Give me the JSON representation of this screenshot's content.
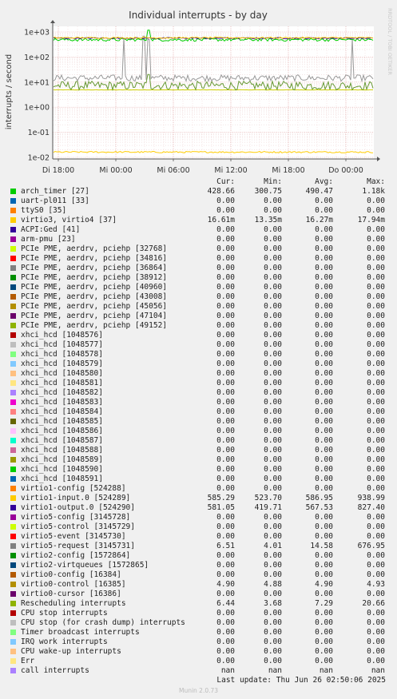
{
  "chart_data": {
    "type": "line",
    "title": "Individual interrupts - by day",
    "ylabel": "interrupts / second",
    "yscale": "log",
    "ylim": [
      0.01,
      1000
    ],
    "y_ticks": [
      {
        "v": 1000,
        "label": "1e+03"
      },
      {
        "v": 100,
        "label": "1e+02"
      },
      {
        "v": 10,
        "label": "1e+01"
      },
      {
        "v": 1,
        "label": "1e+00"
      },
      {
        "v": 0.1,
        "label": "1e-01"
      },
      {
        "v": 0.01,
        "label": "1e-02"
      }
    ],
    "x_ticks": [
      "Di 18:00",
      "Mi 00:00",
      "Mi 06:00",
      "Mi 12:00",
      "Mi 18:00",
      "Do 00:00"
    ],
    "grid": true,
    "side_label": "RRDTOOL / TOBI OETIKER",
    "series": [
      {
        "name": "arch_timer [27]",
        "color": "#00cc00",
        "cur": 428.66,
        "min": 300.75,
        "avg": 490.47,
        "max": 1180
      },
      {
        "name": "virtio3, virtio4 [37]",
        "color": "#ffcc00",
        "cur": 0.01661,
        "min": 0.01335,
        "avg": 0.01627,
        "max": 0.01794
      },
      {
        "name": "virtio1-input.0 [524289]",
        "color": "#ffcc00",
        "cur": 585.29,
        "min": 523.7,
        "avg": 586.95,
        "max": 938.99
      },
      {
        "name": "virtio1-output.0 [524290]",
        "color": "#330099",
        "cur": 581.05,
        "min": 419.71,
        "avg": 567.53,
        "max": 827.4
      },
      {
        "name": "virtio5-request [3145731]",
        "color": "#999999",
        "cur": 6.51,
        "min": 4.01,
        "avg": 14.58,
        "max": 676.95
      },
      {
        "name": "virtio0-control [16385]",
        "color": "#cccc00",
        "cur": 4.9,
        "min": 4.88,
        "avg": 4.9,
        "max": 4.93
      },
      {
        "name": "Rescheduling interrupts",
        "color": "#669933",
        "cur": 6.44,
        "min": 3.68,
        "avg": 7.29,
        "max": 20.66
      }
    ]
  },
  "legend": {
    "headers": [
      "Cur:",
      "Min:",
      "Avg:",
      "Max:"
    ],
    "rows": [
      {
        "color": "#00cc00",
        "name": "arch_timer [27]",
        "cur": "428.66",
        "min": "300.75",
        "avg": "490.47",
        "max": "1.18k"
      },
      {
        "color": "#0066b3",
        "name": "uart-pl011 [33]",
        "cur": "0.00",
        "min": "0.00",
        "avg": "0.00",
        "max": "0.00"
      },
      {
        "color": "#ff8000",
        "name": "ttyS0 [35]",
        "cur": "0.00",
        "min": "0.00",
        "avg": "0.00",
        "max": "0.00"
      },
      {
        "color": "#ffcc00",
        "name": "virtio3, virtio4 [37]",
        "cur": "16.61m",
        "min": "13.35m",
        "avg": "16.27m",
        "max": "17.94m"
      },
      {
        "color": "#330099",
        "name": "ACPI:Ged [41]",
        "cur": "0.00",
        "min": "0.00",
        "avg": "0.00",
        "max": "0.00"
      },
      {
        "color": "#990099",
        "name": "arm-pmu [23]",
        "cur": "0.00",
        "min": "0.00",
        "avg": "0.00",
        "max": "0.00"
      },
      {
        "color": "#ccff00",
        "name": "PCIe PME, aerdrv, pciehp [32768]",
        "cur": "0.00",
        "min": "0.00",
        "avg": "0.00",
        "max": "0.00"
      },
      {
        "color": "#ff0000",
        "name": "PCIe PME, aerdrv, pciehp [34816]",
        "cur": "0.00",
        "min": "0.00",
        "avg": "0.00",
        "max": "0.00"
      },
      {
        "color": "#808080",
        "name": "PCIe PME, aerdrv, pciehp [36864]",
        "cur": "0.00",
        "min": "0.00",
        "avg": "0.00",
        "max": "0.00"
      },
      {
        "color": "#008f00",
        "name": "PCIe PME, aerdrv, pciehp [38912]",
        "cur": "0.00",
        "min": "0.00",
        "avg": "0.00",
        "max": "0.00"
      },
      {
        "color": "#00487d",
        "name": "PCIe PME, aerdrv, pciehp [40960]",
        "cur": "0.00",
        "min": "0.00",
        "avg": "0.00",
        "max": "0.00"
      },
      {
        "color": "#b35a00",
        "name": "PCIe PME, aerdrv, pciehp [43008]",
        "cur": "0.00",
        "min": "0.00",
        "avg": "0.00",
        "max": "0.00"
      },
      {
        "color": "#b38f00",
        "name": "PCIe PME, aerdrv, pciehp [45056]",
        "cur": "0.00",
        "min": "0.00",
        "avg": "0.00",
        "max": "0.00"
      },
      {
        "color": "#6b006b",
        "name": "PCIe PME, aerdrv, pciehp [47104]",
        "cur": "0.00",
        "min": "0.00",
        "avg": "0.00",
        "max": "0.00"
      },
      {
        "color": "#8fb300",
        "name": "PCIe PME, aerdrv, pciehp [49152]",
        "cur": "0.00",
        "min": "0.00",
        "avg": "0.00",
        "max": "0.00"
      },
      {
        "color": "#b30000",
        "name": "xhci_hcd [1048576]",
        "cur": "0.00",
        "min": "0.00",
        "avg": "0.00",
        "max": "0.00"
      },
      {
        "color": "#bebebe",
        "name": "xhci_hcd [1048577]",
        "cur": "0.00",
        "min": "0.00",
        "avg": "0.00",
        "max": "0.00"
      },
      {
        "color": "#80ff80",
        "name": "xhci_hcd [1048578]",
        "cur": "0.00",
        "min": "0.00",
        "avg": "0.00",
        "max": "0.00"
      },
      {
        "color": "#80c9ff",
        "name": "xhci_hcd [1048579]",
        "cur": "0.00",
        "min": "0.00",
        "avg": "0.00",
        "max": "0.00"
      },
      {
        "color": "#ffc080",
        "name": "xhci_hcd [1048580]",
        "cur": "0.00",
        "min": "0.00",
        "avg": "0.00",
        "max": "0.00"
      },
      {
        "color": "#ffe680",
        "name": "xhci_hcd [1048581]",
        "cur": "0.00",
        "min": "0.00",
        "avg": "0.00",
        "max": "0.00"
      },
      {
        "color": "#aa80ff",
        "name": "xhci_hcd [1048582]",
        "cur": "0.00",
        "min": "0.00",
        "avg": "0.00",
        "max": "0.00"
      },
      {
        "color": "#ee00cc",
        "name": "xhci_hcd [1048583]",
        "cur": "0.00",
        "min": "0.00",
        "avg": "0.00",
        "max": "0.00"
      },
      {
        "color": "#ff8080",
        "name": "xhci_hcd [1048584]",
        "cur": "0.00",
        "min": "0.00",
        "avg": "0.00",
        "max": "0.00"
      },
      {
        "color": "#666600",
        "name": "xhci_hcd [1048585]",
        "cur": "0.00",
        "min": "0.00",
        "avg": "0.00",
        "max": "0.00"
      },
      {
        "color": "#ffbfff",
        "name": "xhci_hcd [1048586]",
        "cur": "0.00",
        "min": "0.00",
        "avg": "0.00",
        "max": "0.00"
      },
      {
        "color": "#00ffcc",
        "name": "xhci_hcd [1048587]",
        "cur": "0.00",
        "min": "0.00",
        "avg": "0.00",
        "max": "0.00"
      },
      {
        "color": "#cc6699",
        "name": "xhci_hcd [1048588]",
        "cur": "0.00",
        "min": "0.00",
        "avg": "0.00",
        "max": "0.00"
      },
      {
        "color": "#999900",
        "name": "xhci_hcd [1048589]",
        "cur": "0.00",
        "min": "0.00",
        "avg": "0.00",
        "max": "0.00"
      },
      {
        "color": "#00cc00",
        "name": "xhci_hcd [1048590]",
        "cur": "0.00",
        "min": "0.00",
        "avg": "0.00",
        "max": "0.00"
      },
      {
        "color": "#0066b3",
        "name": "xhci_hcd [1048591]",
        "cur": "0.00",
        "min": "0.00",
        "avg": "0.00",
        "max": "0.00"
      },
      {
        "color": "#ff8000",
        "name": "virtio1-config [524288]",
        "cur": "0.00",
        "min": "0.00",
        "avg": "0.00",
        "max": "0.00"
      },
      {
        "color": "#ffcc00",
        "name": "virtio1-input.0 [524289]",
        "cur": "585.29",
        "min": "523.70",
        "avg": "586.95",
        "max": "938.99"
      },
      {
        "color": "#330099",
        "name": "virtio1-output.0 [524290]",
        "cur": "581.05",
        "min": "419.71",
        "avg": "567.53",
        "max": "827.40"
      },
      {
        "color": "#990099",
        "name": "virtio5-config [3145728]",
        "cur": "0.00",
        "min": "0.00",
        "avg": "0.00",
        "max": "0.00"
      },
      {
        "color": "#ccff00",
        "name": "virtio5-control [3145729]",
        "cur": "0.00",
        "min": "0.00",
        "avg": "0.00",
        "max": "0.00"
      },
      {
        "color": "#ff0000",
        "name": "virtio5-event [3145730]",
        "cur": "0.00",
        "min": "0.00",
        "avg": "0.00",
        "max": "0.00"
      },
      {
        "color": "#808080",
        "name": "virtio5-request [3145731]",
        "cur": "6.51",
        "min": "4.01",
        "avg": "14.58",
        "max": "676.95"
      },
      {
        "color": "#008f00",
        "name": "virtio2-config [1572864]",
        "cur": "0.00",
        "min": "0.00",
        "avg": "0.00",
        "max": "0.00"
      },
      {
        "color": "#00487d",
        "name": "virtio2-virtqueues [1572865]",
        "cur": "0.00",
        "min": "0.00",
        "avg": "0.00",
        "max": "0.00"
      },
      {
        "color": "#b35a00",
        "name": "virtio0-config [16384]",
        "cur": "0.00",
        "min": "0.00",
        "avg": "0.00",
        "max": "0.00"
      },
      {
        "color": "#b38f00",
        "name": "virtio0-control [16385]",
        "cur": "4.90",
        "min": "4.88",
        "avg": "4.90",
        "max": "4.93"
      },
      {
        "color": "#6b006b",
        "name": "virtio0-cursor [16386]",
        "cur": "0.00",
        "min": "0.00",
        "avg": "0.00",
        "max": "0.00"
      },
      {
        "color": "#8fb300",
        "name": "Rescheduling interrupts",
        "cur": "6.44",
        "min": "3.68",
        "avg": "7.29",
        "max": "20.66"
      },
      {
        "color": "#b30000",
        "name": "CPU stop interrupts",
        "cur": "0.00",
        "min": "0.00",
        "avg": "0.00",
        "max": "0.00"
      },
      {
        "color": "#bebebe",
        "name": "CPU stop (for crash dump) interrupts",
        "cur": "0.00",
        "min": "0.00",
        "avg": "0.00",
        "max": "0.00"
      },
      {
        "color": "#80ff80",
        "name": "Timer broadcast interrupts",
        "cur": "0.00",
        "min": "0.00",
        "avg": "0.00",
        "max": "0.00"
      },
      {
        "color": "#80c9ff",
        "name": "IRQ work interrupts",
        "cur": "0.00",
        "min": "0.00",
        "avg": "0.00",
        "max": "0.00"
      },
      {
        "color": "#ffc080",
        "name": "CPU wake-up interrupts",
        "cur": "0.00",
        "min": "0.00",
        "avg": "0.00",
        "max": "0.00"
      },
      {
        "color": "#ffe680",
        "name": "Err",
        "cur": "0.00",
        "min": "0.00",
        "avg": "0.00",
        "max": "0.00"
      },
      {
        "color": "#aa80ff",
        "name": "call interrupts",
        "cur": "nan",
        "min": "nan",
        "avg": "nan",
        "max": "nan"
      }
    ]
  },
  "last_update": "Last update: Thu Jun 26 02:50:06 2025",
  "footer": "Munin 2.0.73"
}
